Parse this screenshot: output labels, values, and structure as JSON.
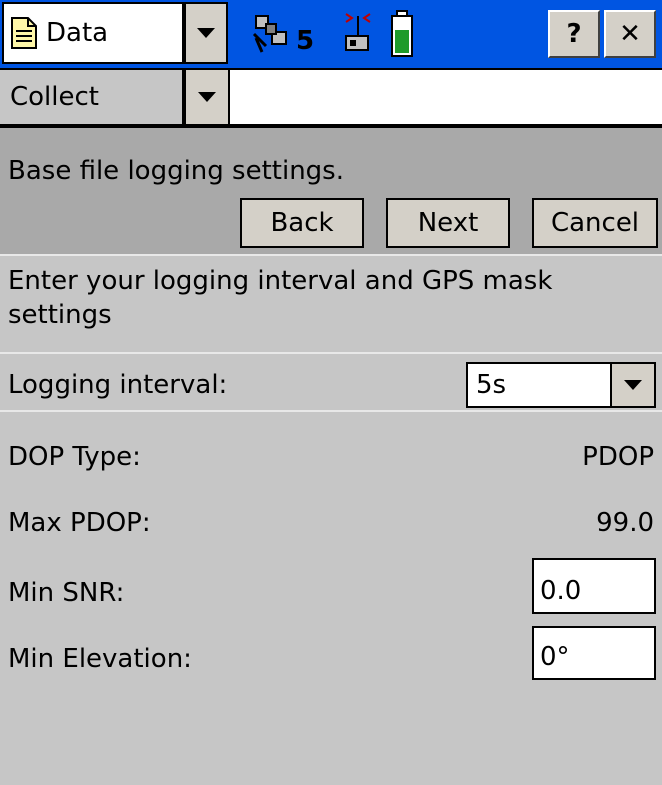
{
  "titlebar": {
    "app_name": "Data",
    "satellite_count": "5",
    "help_label": "?",
    "close_label": "✕",
    "icons": {
      "app": "document-icon",
      "satellite": "satellite-icon",
      "radio": "radio-antenna-icon",
      "battery": "battery-icon"
    }
  },
  "mode_bar": {
    "selected": "Collect"
  },
  "wizard": {
    "title": "Base file logging settings.",
    "back_label": "Back",
    "next_label": "Next",
    "cancel_label": "Cancel"
  },
  "instructions": "Enter your logging interval and GPS mask settings",
  "settings": {
    "logging_interval_label": "Logging interval:",
    "logging_interval_value": "5s",
    "dop_type_label": "DOP Type:",
    "dop_type_value": "PDOP",
    "max_pdop_label": "Max PDOP:",
    "max_pdop_value": "99.0",
    "min_snr_label": "Min SNR:",
    "min_snr_value": "0.0",
    "min_elevation_label": "Min Elevation:",
    "min_elevation_value": "0°"
  },
  "colors": {
    "titlebar": "#0055e2",
    "header_panel": "#a9a9a9",
    "body": "#c6c6c6",
    "battery_fill": "#1e9a2a"
  }
}
